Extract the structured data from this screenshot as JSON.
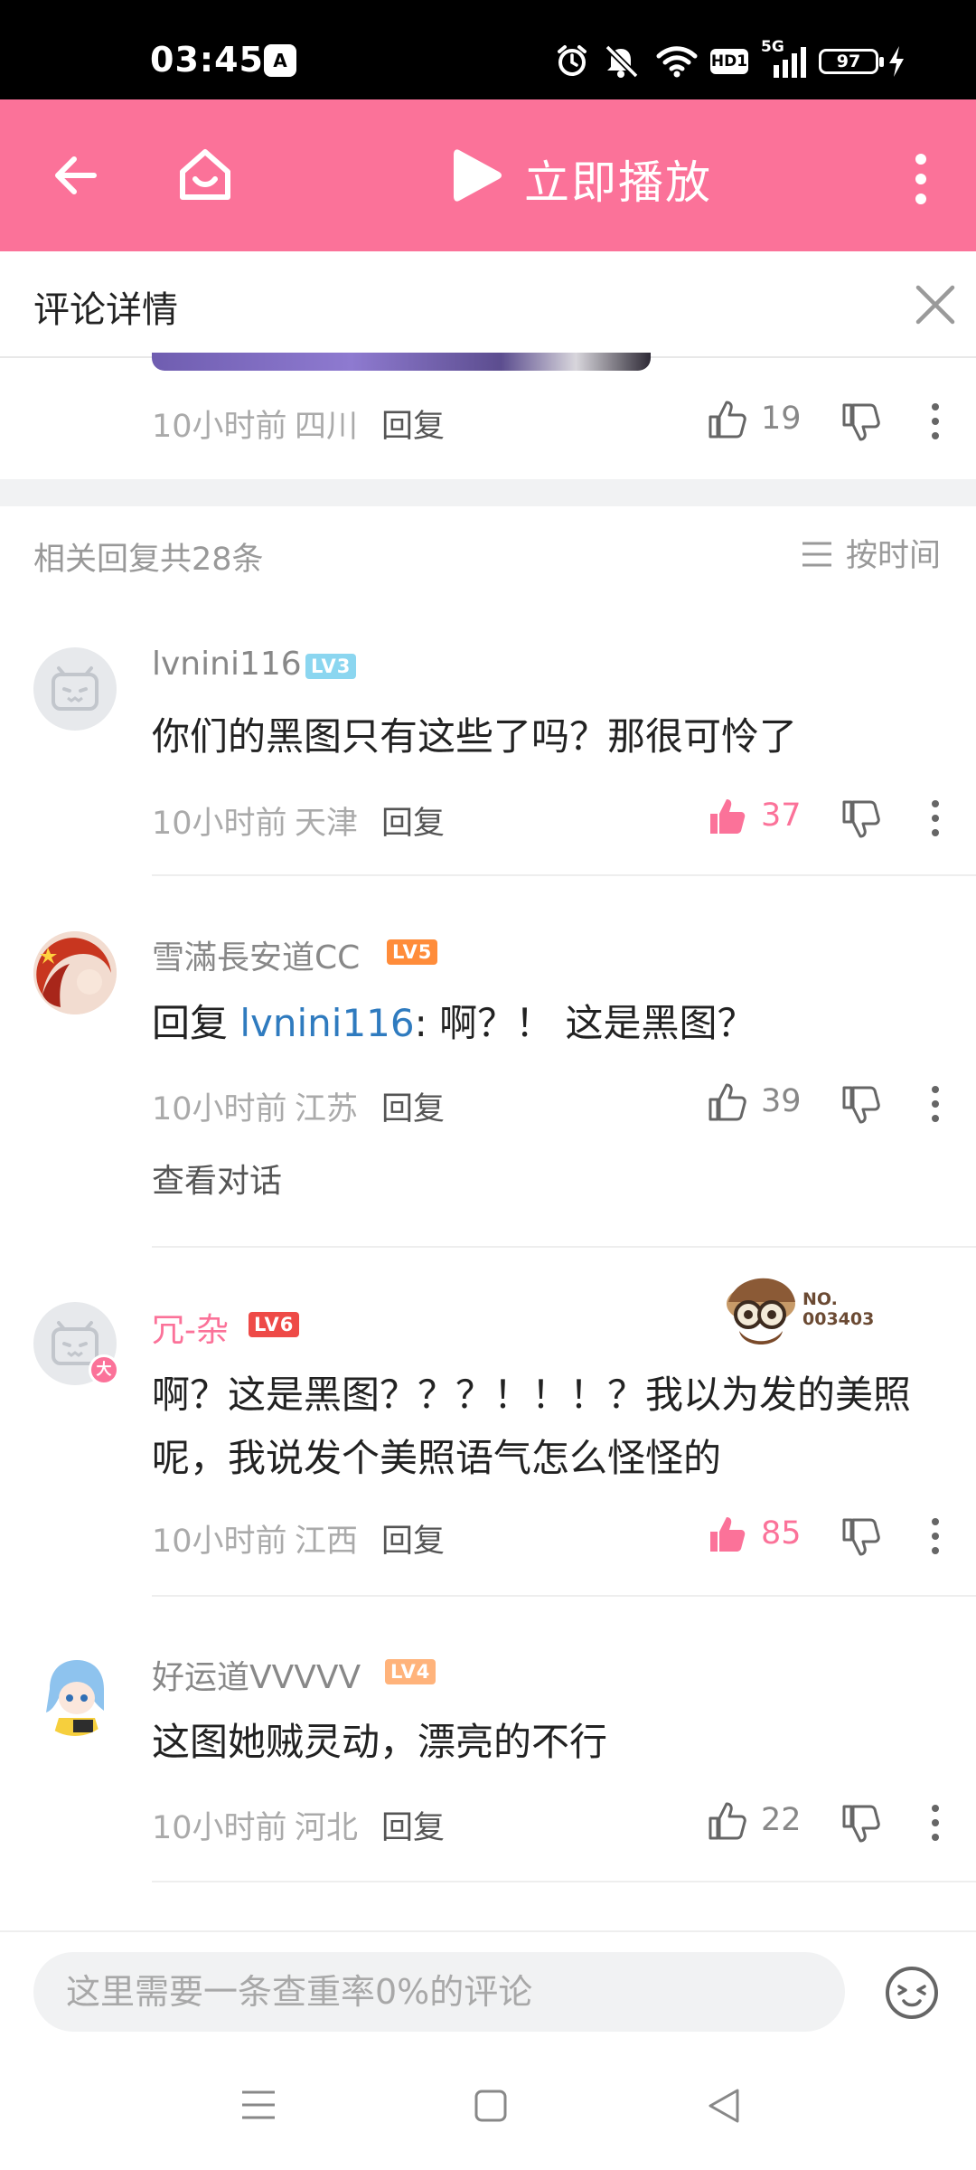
{
  "status_bar": {
    "time": "03:45",
    "ai_badge": "A",
    "signal_label": "5G",
    "hd_label": "HD1",
    "battery": "97"
  },
  "top_bar": {
    "play_label": "立即播放",
    "accent_color": "#fb7299"
  },
  "detail_header": {
    "title": "评论详情"
  },
  "parent_comment": {
    "time": "10小时前",
    "location": "四川",
    "reply_label": "回复",
    "likes": "19"
  },
  "replies_header": {
    "count_text": "相关回复共28条",
    "sort_label": "按时间"
  },
  "replies": [
    {
      "username": "lvnini116",
      "level": "LV3",
      "content": "你们的黑图只有这些了吗？那很可怜了",
      "time": "10小时前",
      "location": "天津",
      "reply_label": "回复",
      "likes": "37",
      "liked": true
    },
    {
      "username": "雪滿長安道CC",
      "level": "LV5",
      "reply_prefix": "回复 ",
      "mention": "lvnini116",
      "content": ": 啊？！ 这是黑图？",
      "time": "10小时前",
      "location": "江苏",
      "reply_label": "回复",
      "likes": "39",
      "liked": false,
      "view_conversation": "查看对话"
    },
    {
      "username": "冗-杂",
      "level": "LV6",
      "badge_text": "NO.\n003403",
      "avatar_badge": "大",
      "content": "啊？这是黑图？？？！！！？我以为发的美照呢，我说发个美照语气怎么怪怪的",
      "time": "10小时前",
      "location": "江西",
      "reply_label": "回复",
      "likes": "85",
      "liked": true
    },
    {
      "username": "好运道VVVVV",
      "level": "LV4",
      "content": "这图她贼灵动，漂亮的不行",
      "time": "10小时前",
      "location": "河北",
      "reply_label": "回复",
      "likes": "22",
      "liked": false
    }
  ],
  "bottom_bar": {
    "input_placeholder": "这里需要一条查重率0%的评论"
  }
}
